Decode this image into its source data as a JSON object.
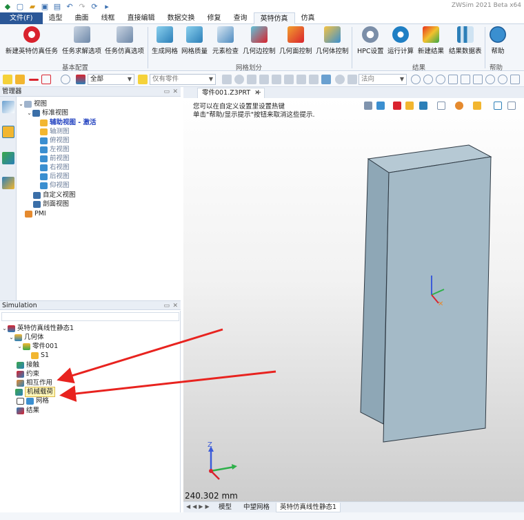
{
  "app": {
    "title": "ZWSim 2021 Beta x64"
  },
  "menu": {
    "tabs": [
      {
        "label": "文件(F)"
      },
      {
        "label": "造型"
      },
      {
        "label": "曲面"
      },
      {
        "label": "线框"
      },
      {
        "label": "直接编辑"
      },
      {
        "label": "数据交换"
      },
      {
        "label": "修复"
      },
      {
        "label": "查询"
      },
      {
        "label": "英特仿真"
      },
      {
        "label": "仿真"
      }
    ]
  },
  "ribbon": {
    "buttons": [
      {
        "label": "新建英特仿真任务"
      },
      {
        "label": "任务求解选项"
      },
      {
        "label": "任务仿真选项"
      },
      {
        "label": "生成网格"
      },
      {
        "label": "网格质量"
      },
      {
        "label": "元素检查"
      },
      {
        "label": "几何边控制"
      },
      {
        "label": "几何面控制"
      },
      {
        "label": "几何体控制"
      },
      {
        "label": "HPC设置"
      },
      {
        "label": "运行计算"
      },
      {
        "label": "新建结果"
      },
      {
        "label": "结果数据表"
      },
      {
        "label": "帮助"
      }
    ],
    "groups": [
      {
        "label": "基本配置"
      },
      {
        "label": "网格划分"
      },
      {
        "label": "结果"
      },
      {
        "label": "帮助"
      }
    ]
  },
  "toolbar": {
    "filter_value": "全部",
    "part_filter_value": "仅有零件",
    "view_value": "法向"
  },
  "manager": {
    "title": "管理器",
    "tree": [
      {
        "label": "视图"
      },
      {
        "label": "标准视图"
      },
      {
        "label": "辅助视图 - 激活"
      },
      {
        "label": "轴测图"
      },
      {
        "label": "俯视图"
      },
      {
        "label": "左视图"
      },
      {
        "label": "前视图"
      },
      {
        "label": "右视图"
      },
      {
        "label": "后视图"
      },
      {
        "label": "仰视图"
      },
      {
        "label": "自定义视图"
      },
      {
        "label": "剖面视图"
      },
      {
        "label": "PMI"
      }
    ]
  },
  "simulation": {
    "title": "Simulation",
    "tree": [
      {
        "label": "英特仿真线性静态1"
      },
      {
        "label": "几何体"
      },
      {
        "label": "零件001"
      },
      {
        "label": "S1"
      },
      {
        "label": "接触"
      },
      {
        "label": "约束"
      },
      {
        "label": "相互作用"
      },
      {
        "label": "机械载荷"
      },
      {
        "label": "网格"
      },
      {
        "label": "结果"
      }
    ]
  },
  "document": {
    "tab_label": "零件001.Z3PRT",
    "close_glyph": "✕",
    "plus_glyph": "+"
  },
  "viewport": {
    "hint_line1": "您可以在自定义设置里设置热键",
    "hint_line2": "单击\"帮助/显示提示\"按钮来取消这些提示.",
    "scale": "240.302 mm",
    "axis_z": "Z"
  },
  "bottom_tabs": [
    {
      "label": "模型"
    },
    {
      "label": "中望网格"
    },
    {
      "label": "英特仿真线性静态1"
    }
  ],
  "colors": {
    "accent": "#2b5797",
    "solid": "#9fb6c4",
    "arrow": "#e8231f"
  }
}
